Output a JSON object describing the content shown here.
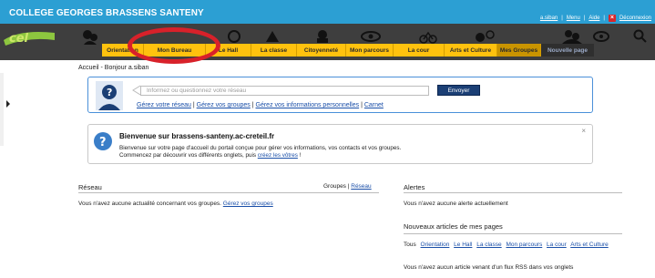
{
  "header": {
    "school_name": "COLLEGE GEORGES BRASSENS SANTENY",
    "links": [
      "a.siban",
      "Menu",
      "Aide"
    ],
    "logout_label": "Déconnexion"
  },
  "tabs": [
    {
      "label": "Orientation"
    },
    {
      "label": "Mon Bureau"
    },
    {
      "label": "Le Hall"
    },
    {
      "label": "La classe"
    },
    {
      "label": "Citoyenneté"
    },
    {
      "label": "Mon parcours"
    },
    {
      "label": "La cour"
    },
    {
      "label": "Arts et Culture"
    },
    {
      "label": "Mes Groupes"
    },
    {
      "label": "Nouvelle page"
    }
  ],
  "breadcrumb": "Accueil - Bonjour a.siban",
  "network": {
    "placeholder": "Informez ou questionnez votre réseau",
    "send_label": "Envoyer",
    "links": [
      "Gérez votre réseau",
      "Gérez vos groupes",
      "Gérez vos informations personnelles",
      "Carnet"
    ]
  },
  "welcome": {
    "title": "Bienvenue sur brassens-santeny.ac-creteil.fr",
    "line1": "Bienvenue sur votre page d'accueil du portail conçue pour gérer vos informations, vos contacts et vos groupes.",
    "line2_prefix": "Commencez par découvrir vos différents onglets, puis ",
    "line2_link": "créez les vôtres",
    "line2_suffix": " !",
    "close": "×"
  },
  "reseau": {
    "title": "Réseau",
    "groupes": "Groupes",
    "reseau_link": "Réseau",
    "empty_text": "Vous n'avez aucune actualité concernant vos groupes.",
    "manage_link": "Gérez vos groupes"
  },
  "alertes": {
    "title": "Alertes",
    "empty_text": "Vous n'avez aucune alerte actuellement"
  },
  "nouveaux": {
    "title": "Nouveaux articles de mes pages",
    "filters": [
      "Tous",
      "Orientation",
      "Le Hall",
      "La classe",
      "Mon parcours",
      "La cour",
      "Arts et Culture"
    ],
    "empty_text": "Vous n'avez aucun article venant d'un flux RSS dans vos onglets"
  },
  "colors": {
    "top_banner": "#2c9fd3",
    "nav_background": "#3e3e3e",
    "tab_yellow": "#ffc20e",
    "highlight_red": "#d8212a",
    "button_navy": "#1b3f75"
  }
}
